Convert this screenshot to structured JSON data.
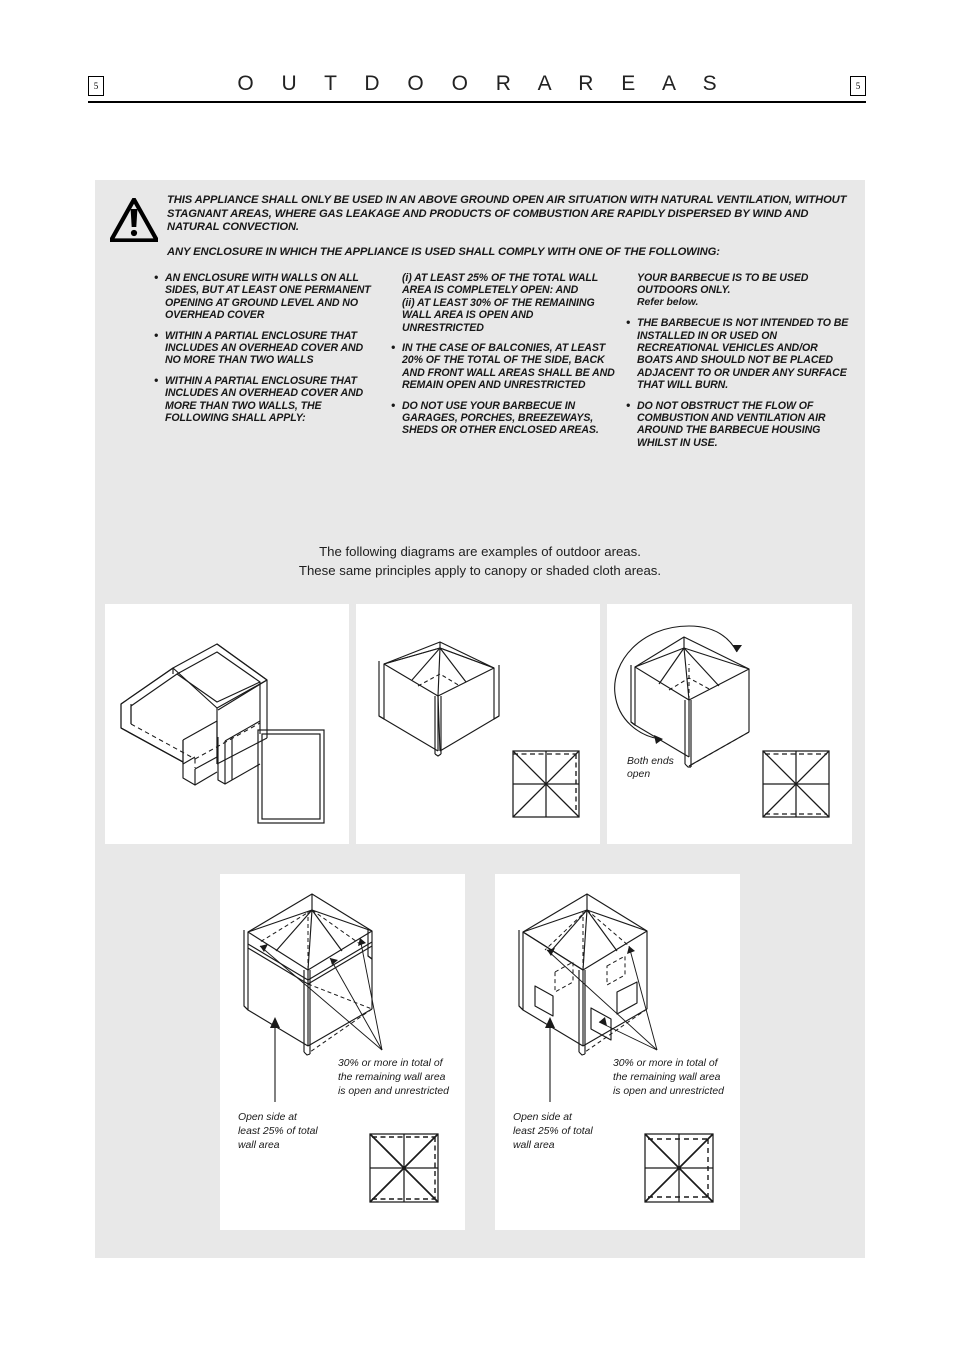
{
  "header": {
    "title": "O U T D O O R     A R E A S",
    "page_number_left": "5",
    "page_number_right": "5"
  },
  "warning": {
    "icon": "warning-triangle-icon",
    "paragraph_1": "THIS APPLIANCE SHALL ONLY BE USED IN AN ABOVE GROUND OPEN AIR SITUATION WITH NATURAL VENTILATION, WITHOUT STAGNANT AREAS, WHERE GAS LEAKAGE AND PRODUCTS OF COMBUSTION ARE RAPIDLY DISPERSED BY WIND AND NATURAL CONVECTION.",
    "paragraph_2": "ANY ENCLOSURE IN WHICH THE APPLIANCE IS USED SHALL COMPLY WITH ONE OF THE FOLLOWING:"
  },
  "columns": {
    "column_1": [
      {
        "bullet": "•",
        "text": "AN ENCLOSURE WITH WALLS ON ALL SIDES, BUT AT LEAST ONE PERMANENT OPENING AT GROUND LEVEL AND NO OVERHEAD COVER"
      },
      {
        "bullet": "•",
        "text": "WITHIN A PARTIAL ENCLOSURE THAT INCLUDES AN OVERHEAD COVER AND NO MORE THAN TWO WALLS"
      },
      {
        "bullet": "•",
        "text": "WITHIN A PARTIAL ENCLOSURE THAT INCLUDES AN OVERHEAD COVER AND MORE THAN TWO WALLS, THE FOLLOWING SHALL APPLY:"
      }
    ],
    "column_2": [
      {
        "bullet": "",
        "text": "(i) AT LEAST 25% OF THE TOTAL WALL AREA IS COMPLETELY OPEN: AND"
      },
      {
        "bullet": "",
        "text": "(ii) AT LEAST 30% OF THE REMAINING WALL AREA IS OPEN AND UNRESTRICTED"
      },
      {
        "bullet": "•",
        "text": "IN THE CASE OF BALCONIES, AT LEAST 20% OF THE TOTAL OF THE SIDE, BACK AND FRONT WALL AREAS SHALL BE AND REMAIN OPEN AND UNRESTRICTED"
      },
      {
        "bullet": "•",
        "text": "DO NOT USE YOUR BARBECUE IN GARAGES, PORCHES, BREEZEWAYS, SHEDS OR OTHER ENCLOSED AREAS."
      }
    ],
    "column_3": [
      {
        "bullet": "",
        "text": "YOUR BARBECUE IS TO BE USED OUTDOORS ONLY."
      },
      {
        "bullet": "",
        "text": "Refer below."
      },
      {
        "bullet": "•",
        "text": "THE BARBECUE IS NOT INTENDED TO BE INSTALLED IN OR USED ON RECREATIONAL VEHICLES AND/OR BOATS AND SHOULD NOT BE PLACED ADJACENT TO OR UNDER ANY SURFACE THAT WILL BURN."
      },
      {
        "bullet": "•",
        "text": "DO NOT OBSTRUCT THE FLOW OF COMBUSTION AND VENTILATION AIR AROUND THE BARBECUE HOUSING WHILST IN USE."
      }
    ]
  },
  "intro": {
    "line_1": "The following diagrams are examples of outdoor areas.",
    "line_2": "These same principles apply to canopy or shaded cloth areas."
  },
  "diagrams": {
    "panel_1": {
      "name": "walled-enclosure-open-top",
      "captions": []
    },
    "panel_2": {
      "name": "umbrella-canopy-two-walls",
      "captions": []
    },
    "panel_3": {
      "name": "canopy-both-ends-open",
      "caption_line_1": "Both ends",
      "caption_line_2": "open"
    },
    "panel_4": {
      "name": "canopy-three-walls-open-side",
      "caption_30_line_1": "30% or more in total of",
      "caption_30_line_2": "the remaining wall area",
      "caption_30_line_3": "is open and unrestricted",
      "caption_open_line_1": "Open side at",
      "caption_open_line_2": "least 25% of total",
      "caption_open_line_3": "wall area"
    },
    "panel_5": {
      "name": "canopy-three-walls-with-windows",
      "caption_30_line_1": "30% or more in total of",
      "caption_30_line_2": "the remaining wall area",
      "caption_30_line_3": "is open and unrestricted",
      "caption_open_line_1": "Open side at",
      "caption_open_line_2": "least 25% of total",
      "caption_open_line_3": "wall area"
    }
  },
  "colors": {
    "panel_background": "#e8e8e8",
    "page_background": "#ffffff",
    "line": "#1a1a1a"
  }
}
